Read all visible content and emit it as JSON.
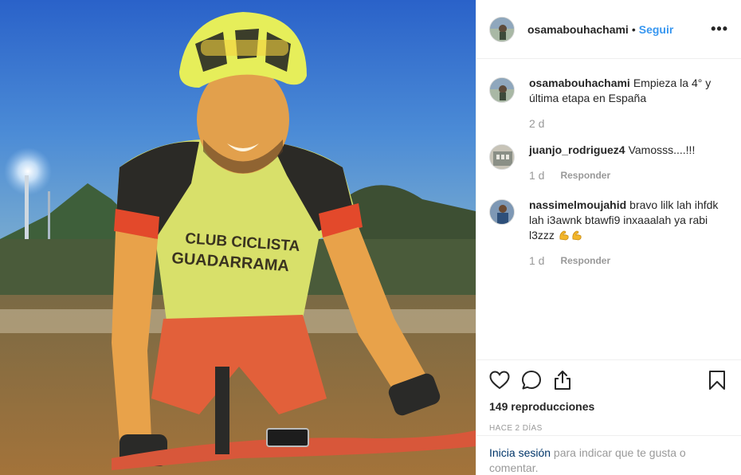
{
  "post": {
    "author": "osamabouhachami",
    "separator": "•",
    "follow_label": "Seguir",
    "more_label": "•••"
  },
  "comments": [
    {
      "user": "osamabouhachami",
      "text": "Empieza la 4° y última etapa en España",
      "time": "2 d",
      "reply_label": ""
    },
    {
      "user": "juanjo_rodriguez4",
      "text": "Vamosss....!!!",
      "time": "1 d",
      "reply_label": "Responder"
    },
    {
      "user": "nassimelmoujahid",
      "text": "bravo lilk lah ihfdk lah i3awnk btawfi9 inxaaalah ya rabi l3zzz",
      "emoji": "flexed-biceps-emoji",
      "time": "1 d",
      "reply_label": "Responder"
    }
  ],
  "actions": {
    "like_icon": "heart-icon",
    "comment_icon": "comment-bubble-icon",
    "share_icon": "share-icon",
    "save_icon": "bookmark-icon",
    "views": "149 reproducciones",
    "posted_ago": "HACE 2 DÍAS"
  },
  "login_prompt": {
    "link_label": "Inicia sesión",
    "rest": " para indicar que te gusta o comentar."
  },
  "media": {
    "jersey_text": "CLUB CICLISTA GUADARRAMA"
  },
  "colors": {
    "link": "#003569",
    "follow": "#3897f0",
    "muted": "#999999"
  }
}
